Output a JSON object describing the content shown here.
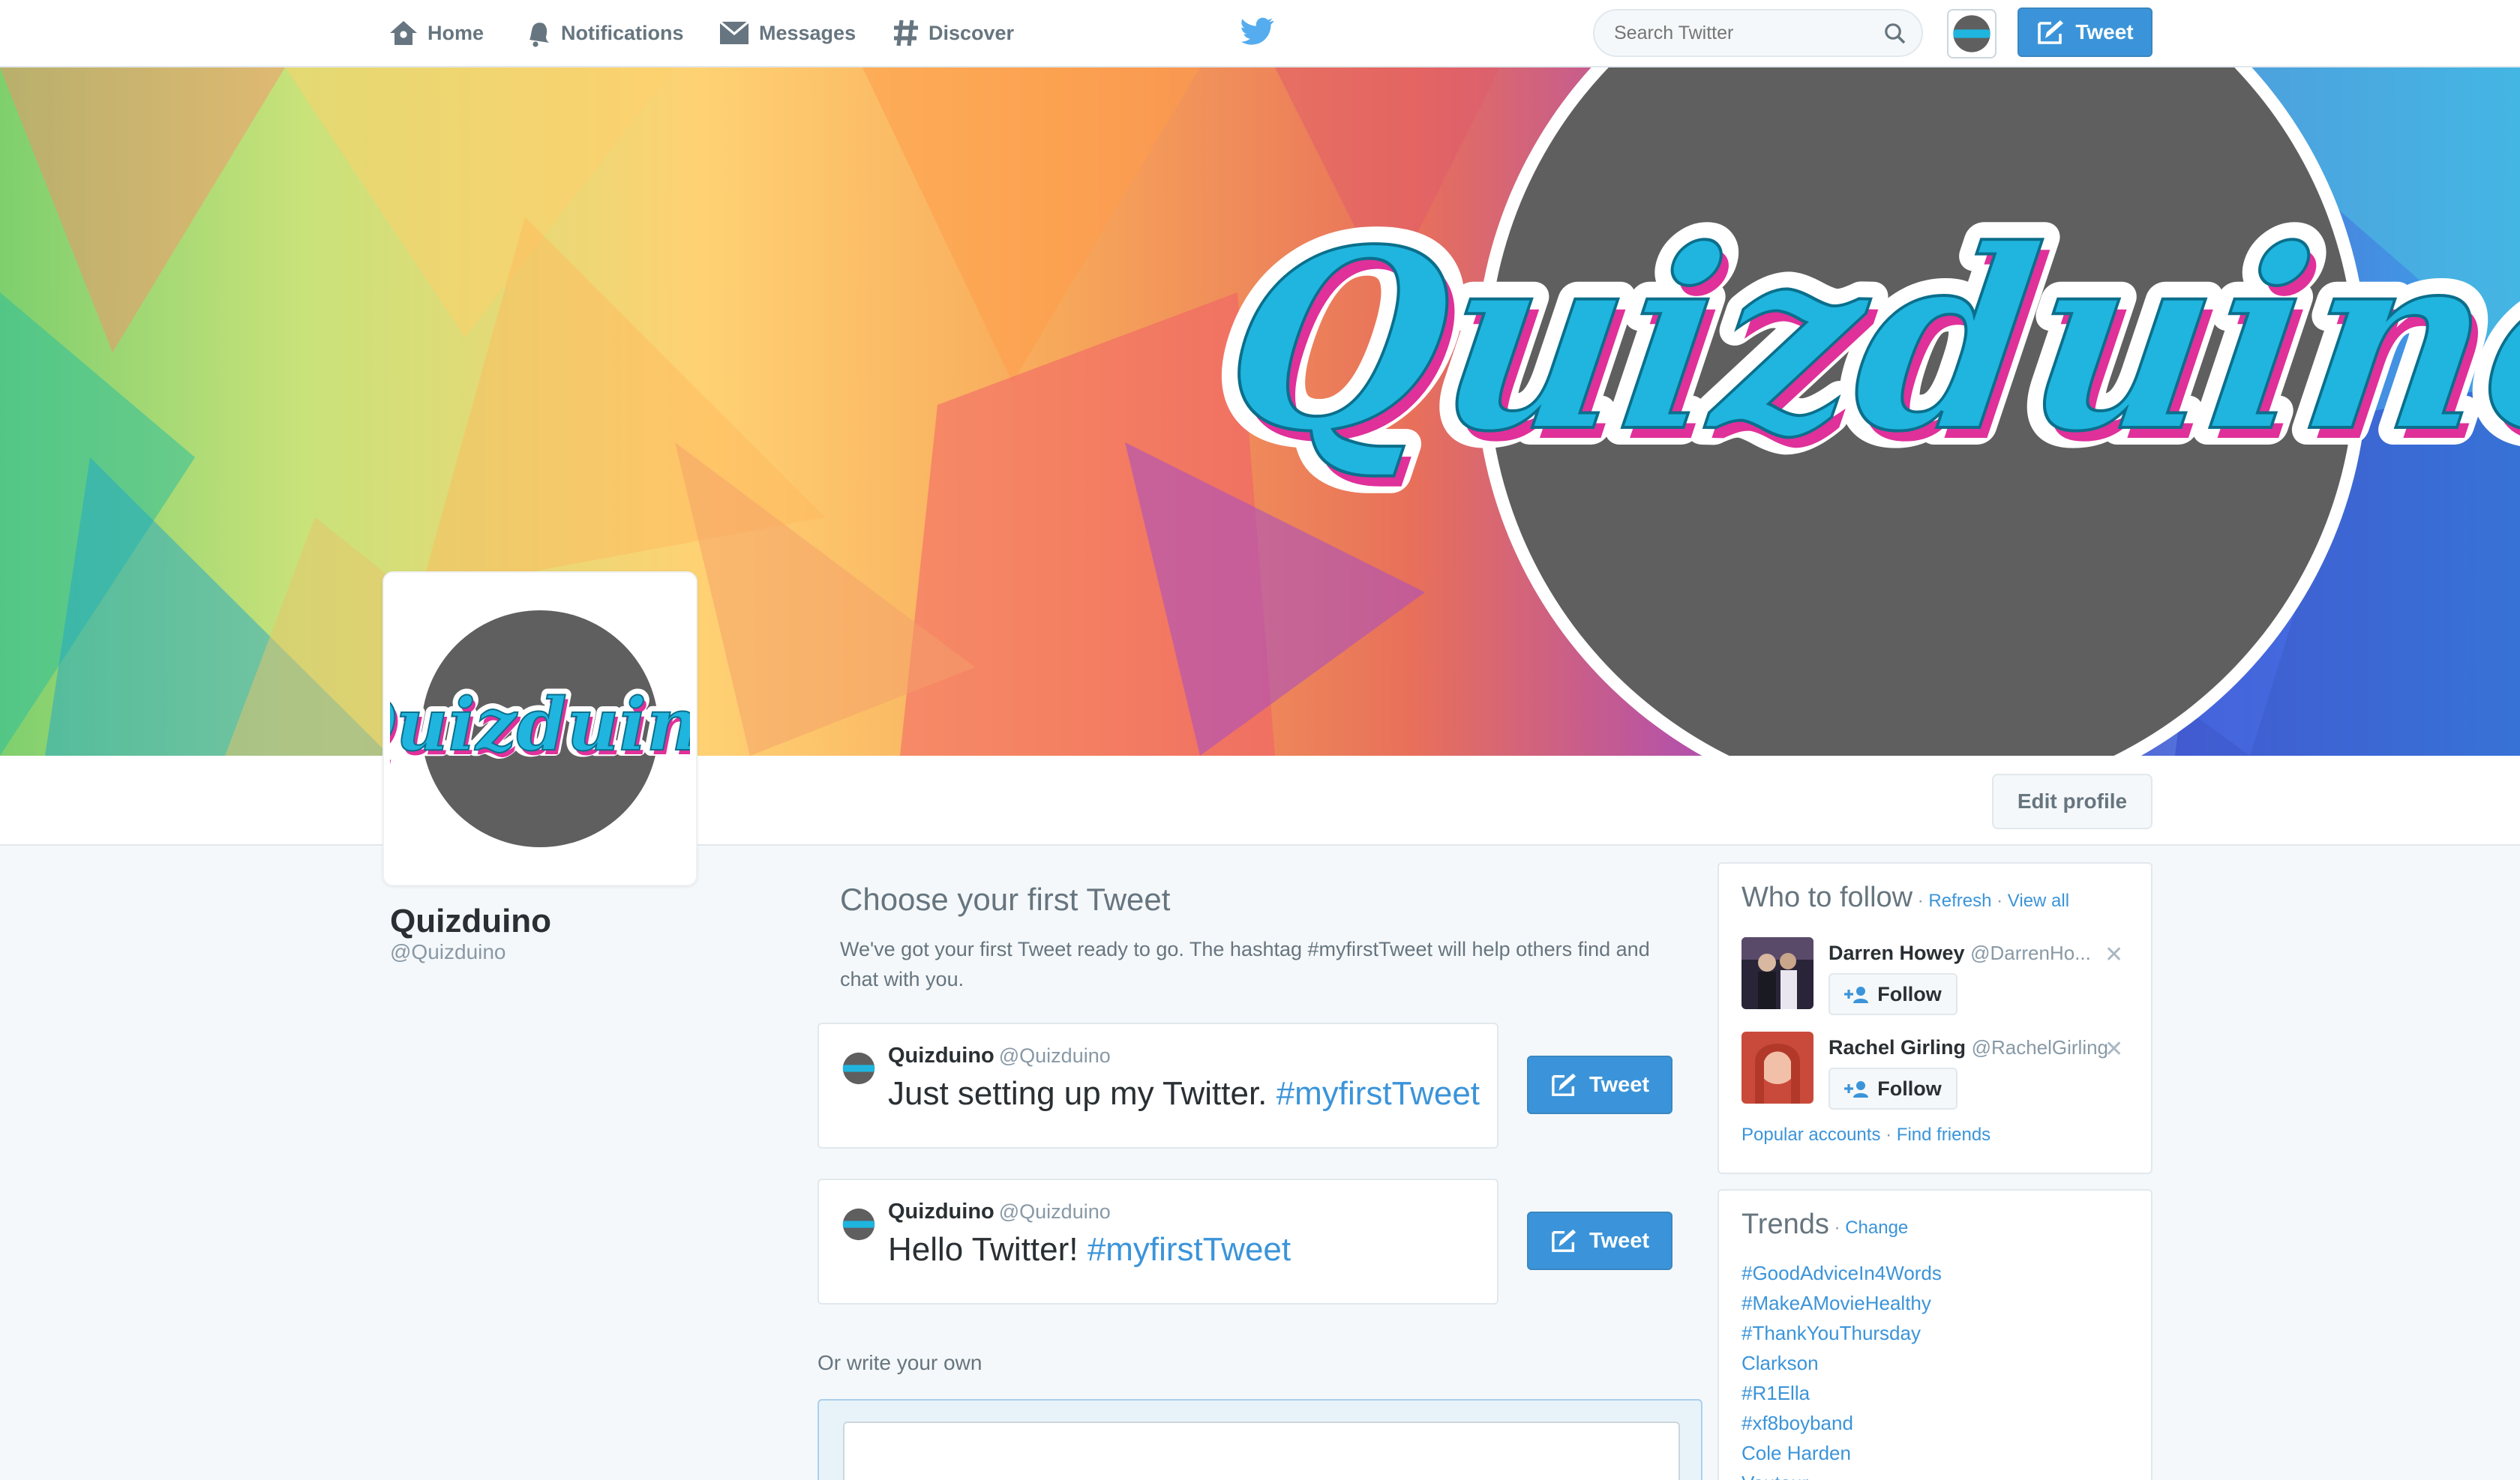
{
  "nav": {
    "home": "Home",
    "notifications": "Notifications",
    "messages": "Messages",
    "discover": "Discover",
    "search_placeholder": "Search Twitter",
    "tweet_button": "Tweet"
  },
  "banner": {
    "logo_text": "Quizduino"
  },
  "profile": {
    "name": "Quizduino",
    "handle": "@Quizduino",
    "edit_button": "Edit profile",
    "avatar_text": "Quizduino"
  },
  "first_tweet": {
    "title": "Choose your first Tweet",
    "description": "We've got your first Tweet ready to go. The hashtag #myfirstTweet will help others find and chat with you.",
    "cards": [
      {
        "name": "Quizduino",
        "handle": "@Quizduino",
        "text": "Just setting up my Twitter. ",
        "hashtag": "#myfirstTweet",
        "button": "Tweet"
      },
      {
        "name": "Quizduino",
        "handle": "@Quizduino",
        "text": "Hello Twitter! ",
        "hashtag": "#myfirstTweet",
        "button": "Tweet"
      }
    ],
    "write_own": "Or write your own"
  },
  "who_to_follow": {
    "title": "Who to follow",
    "refresh": "Refresh",
    "view_all": "View all",
    "separator": " · ",
    "users": [
      {
        "name": "Darren Howey",
        "handle": "@DarrenHo...",
        "follow": "Follow"
      },
      {
        "name": "Rachel Girling",
        "handle": "@RachelGirling",
        "follow": "Follow"
      }
    ],
    "popular_accounts": "Popular accounts",
    "find_friends": "Find friends"
  },
  "trends": {
    "title": "Trends",
    "change": "Change",
    "items": [
      "#GoodAdviceIn4Words",
      "#MakeAMovieHealthy",
      "#ThankYouThursday",
      "Clarkson",
      "#R1Ella",
      "#xf8boyband",
      "Cole Harden",
      "Vautour"
    ]
  },
  "colors": {
    "accent": "#3b94d9",
    "logo_blue": "#1fb5df",
    "logo_pink": "#e0309a",
    "logo_circle": "#5f5f5f"
  }
}
